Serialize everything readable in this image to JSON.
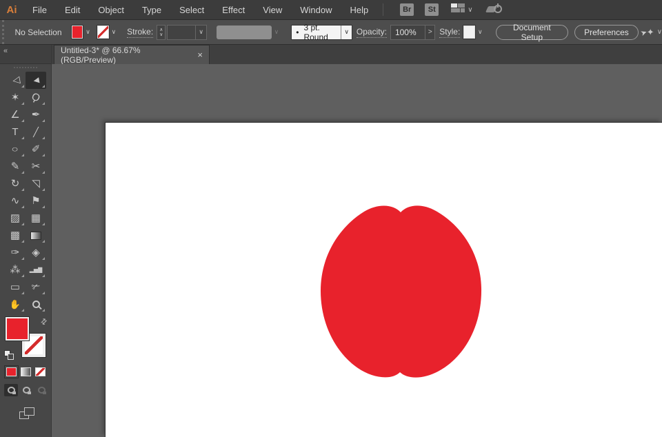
{
  "colors": {
    "red": "#E8222C",
    "ui_dark": "#3C3C3C",
    "pasteboard": "#5F5F5F"
  },
  "menu_bar": {
    "logo": "Ai",
    "items": [
      "File",
      "Edit",
      "Object",
      "Type",
      "Select",
      "Effect",
      "View",
      "Window",
      "Help"
    ],
    "bridge_label": "Br",
    "stock_label": "St",
    "workspace_chevron": "∨"
  },
  "control_bar": {
    "selection_status": "No Selection",
    "fill_chevron": "∨",
    "stroke_chevron": "∨",
    "stroke_label": "Stroke:",
    "stepper_up": "∧",
    "stepper_down": "∨",
    "stroke_width_chevron": "∨",
    "brush_chevron": "∨",
    "brush_definition_dot": "•",
    "brush_definition": "3 pt. Round",
    "brush_definition_chevron": "∨",
    "opacity_label": "Opacity:",
    "opacity_value": "100%",
    "opacity_chevron": ">",
    "style_label": "Style:",
    "style_chevron": "∨",
    "document_setup_label": "Document Setup",
    "preferences_label": "Preferences",
    "touch_glyph": "✦",
    "touch_cursor_glyph": "➤",
    "touch_chevron": "∨"
  },
  "tab": {
    "title": "Untitled-3* @ 66.67% (RGB/Preview)",
    "close_glyph": "×"
  },
  "toolbar": {
    "collapse_glyph": "«",
    "swap_glyph": "⇄",
    "tools": [
      {
        "name": "selection-tool",
        "glyph": "△",
        "active": false
      },
      {
        "name": "direct-selection-tool",
        "glyph": "▲",
        "active": true
      },
      {
        "name": "magic-wand-tool",
        "glyph": "✶",
        "active": false
      },
      {
        "name": "lasso-tool",
        "glyph": "Ϙ",
        "active": false
      },
      {
        "name": "curvature-tool",
        "glyph": "∠",
        "active": false
      },
      {
        "name": "pen-tool",
        "glyph": "✒",
        "active": false
      },
      {
        "name": "type-tool",
        "glyph": "T",
        "active": false
      },
      {
        "name": "line-segment-tool",
        "glyph": "╱",
        "active": false
      },
      {
        "name": "ellipse-tool",
        "glyph": "○",
        "active": false
      },
      {
        "name": "paintbrush-tool",
        "glyph": "✐",
        "active": false
      },
      {
        "name": "shaper-tool",
        "glyph": "✎",
        "active": false
      },
      {
        "name": "scissors-tool",
        "glyph": "✂",
        "active": false
      },
      {
        "name": "rotate-tool",
        "glyph": "↻",
        "active": false
      },
      {
        "name": "scale-tool",
        "glyph": "◹",
        "active": false
      },
      {
        "name": "width-tool",
        "glyph": "∿",
        "active": false
      },
      {
        "name": "puppet-warp-tool",
        "glyph": "⚑",
        "active": false
      },
      {
        "name": "shape-builder-tool",
        "glyph": "▨",
        "active": false
      },
      {
        "name": "perspective-grid-tool",
        "glyph": "▦",
        "active": false
      },
      {
        "name": "mesh-tool",
        "glyph": "▩",
        "active": false
      },
      {
        "name": "gradient-tool",
        "glyph": "",
        "active": false
      },
      {
        "name": "eyedropper-tool",
        "glyph": "✑",
        "active": false
      },
      {
        "name": "blend-tool",
        "glyph": "◈",
        "active": false
      },
      {
        "name": "symbol-sprayer-tool",
        "glyph": "⁂",
        "active": false
      },
      {
        "name": "column-graph-tool",
        "glyph": "▂▅▇",
        "active": false
      },
      {
        "name": "artboard-tool",
        "glyph": "▭",
        "active": false
      },
      {
        "name": "slice-tool",
        "glyph": "✃",
        "active": false
      },
      {
        "name": "hand-tool",
        "glyph": "✋",
        "active": false
      },
      {
        "name": "zoom-tool",
        "glyph": "",
        "active": false
      }
    ],
    "color_modes": [
      {
        "name": "color-mode-button",
        "style": "mode-color",
        "selected": true
      },
      {
        "name": "gradient-mode-button",
        "style": "mode-grad",
        "selected": false
      },
      {
        "name": "none-mode-button",
        "style": "mode-none",
        "selected": false
      }
    ],
    "drawing_modes": [
      {
        "name": "draw-normal-button",
        "selected": true,
        "dim": false
      },
      {
        "name": "draw-behind-button",
        "selected": false,
        "dim": false
      },
      {
        "name": "draw-inside-button",
        "selected": false,
        "dim": true
      }
    ]
  },
  "artboard": {
    "shape_name": "apple-shape",
    "fill": "#E8222C"
  }
}
